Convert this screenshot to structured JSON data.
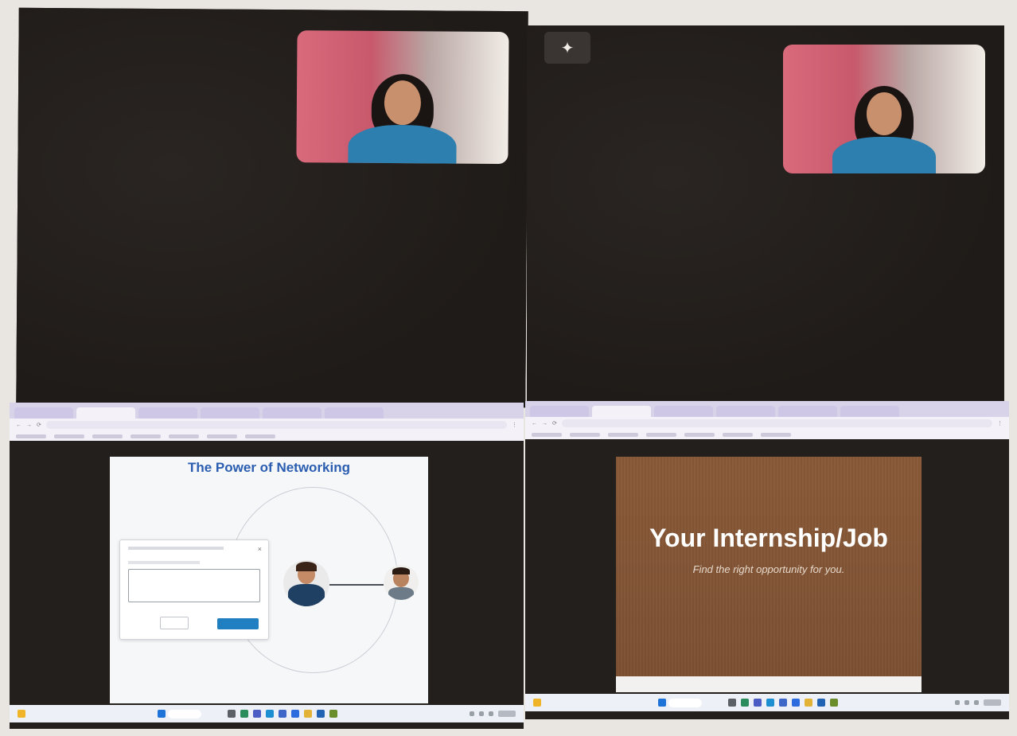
{
  "panels": {
    "top_left": {},
    "top_right": {
      "corner_icon": "sparkle-icon"
    },
    "bottom_left": {
      "slide_title": "The Power of Networking",
      "browser_tabs": [
        "",
        "",
        "",
        "",
        "",
        ""
      ],
      "dialog": {
        "cancel_label": "",
        "send_label": ""
      }
    },
    "bottom_right": {
      "slide_title": "Your Internship/Job",
      "slide_subtitle": "Find the right opportunity for you."
    }
  },
  "taskbar": {
    "search_placeholder": ""
  },
  "colors": {
    "meeting_background": "#231f1c",
    "slide1_title": "#2a5db0",
    "slide2_background": "#8a5a38",
    "send_button": "#1f7fc1"
  }
}
